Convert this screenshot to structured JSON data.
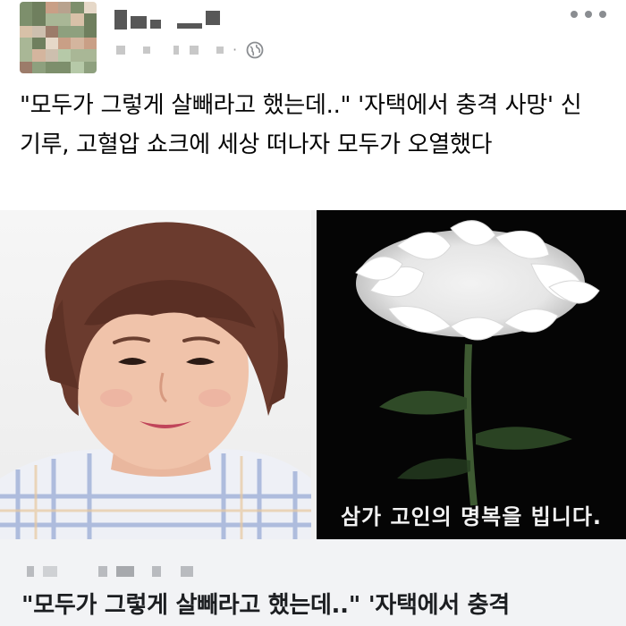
{
  "post": {
    "text": "\"모두가 그렇게 살빼라고 했는데..\" '자택에서 충격 사망' 신기루, 고혈압 쇼크에 세상 떠나자 모두가 오열했다",
    "privacy_icon": "globe-icon",
    "menu_icon": "more-icon"
  },
  "link_preview": {
    "right_caption": "삼가 고인의 명복을 빕니다.",
    "title": "\"모두가 그렇게 살빼라고 했는데..\" '자택에서 충격"
  },
  "colors": {
    "accent": "#1877f2",
    "caption_bg": "#f2f3f5",
    "memorial_bg": "#050505"
  }
}
